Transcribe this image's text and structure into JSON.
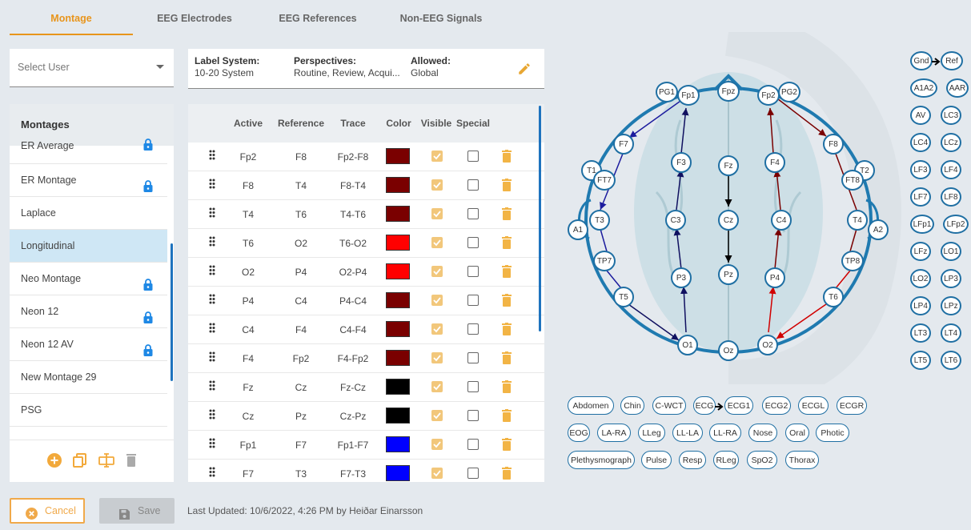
{
  "tabs": [
    {
      "label": "Montage",
      "active": true
    },
    {
      "label": "EEG Electrodes"
    },
    {
      "label": "EEG References"
    },
    {
      "label": "Non-EEG Signals"
    }
  ],
  "select_user": {
    "placeholder": "Select User"
  },
  "label_bar": {
    "label_system": {
      "title": "Label System:",
      "value": "10-20 System"
    },
    "perspectives": {
      "title": "Perspectives:",
      "value": "Routine, Review, Acqui..."
    },
    "allowed": {
      "title": "Allowed:",
      "value": "Global"
    }
  },
  "montages": {
    "header": "Montages",
    "items": [
      {
        "label": "ER Average",
        "locked": true
      },
      {
        "label": "ER Montage",
        "locked": true
      },
      {
        "label": "Laplace",
        "locked": false
      },
      {
        "label": "Longitudinal",
        "locked": false,
        "selected": true
      },
      {
        "label": "Neo Montage",
        "locked": true
      },
      {
        "label": "Neon 12",
        "locked": true
      },
      {
        "label": "Neon 12 AV",
        "locked": true
      },
      {
        "label": "New Montage 29",
        "locked": false
      },
      {
        "label": "PSG",
        "locked": false
      }
    ]
  },
  "table": {
    "columns": {
      "active": "Active",
      "reference": "Reference",
      "trace": "Trace",
      "color": "Color",
      "visible": "Visible",
      "special": "Special"
    },
    "rows": [
      {
        "active": "Fp2",
        "reference": "F8",
        "trace": "Fp2-F8",
        "color": "#7a0000",
        "visible": true,
        "special": false
      },
      {
        "active": "F8",
        "reference": "T4",
        "trace": "F8-T4",
        "color": "#7a0000",
        "visible": true,
        "special": false
      },
      {
        "active": "T4",
        "reference": "T6",
        "trace": "T4-T6",
        "color": "#7a0000",
        "visible": true,
        "special": false
      },
      {
        "active": "T6",
        "reference": "O2",
        "trace": "T6-O2",
        "color": "#ff0000",
        "visible": true,
        "special": false
      },
      {
        "active": "O2",
        "reference": "P4",
        "trace": "O2-P4",
        "color": "#ff0000",
        "visible": true,
        "special": false
      },
      {
        "active": "P4",
        "reference": "C4",
        "trace": "P4-C4",
        "color": "#7a0000",
        "visible": true,
        "special": false
      },
      {
        "active": "C4",
        "reference": "F4",
        "trace": "C4-F4",
        "color": "#7a0000",
        "visible": true,
        "special": false
      },
      {
        "active": "F4",
        "reference": "Fp2",
        "trace": "F4-Fp2",
        "color": "#7a0000",
        "visible": true,
        "special": false
      },
      {
        "active": "Fz",
        "reference": "Cz",
        "trace": "Fz-Cz",
        "color": "#000000",
        "visible": true,
        "special": false
      },
      {
        "active": "Cz",
        "reference": "Pz",
        "trace": "Cz-Pz",
        "color": "#000000",
        "visible": true,
        "special": false
      },
      {
        "active": "Fp1",
        "reference": "F7",
        "trace": "Fp1-F7",
        "color": "#0000ff",
        "visible": true,
        "special": false
      },
      {
        "active": "F7",
        "reference": "T3",
        "trace": "F7-T3",
        "color": "#0000ff",
        "visible": true,
        "special": false
      }
    ]
  },
  "footer": {
    "cancel": "Cancel",
    "save": "Save",
    "last_updated": "Last Updated: 10/6/2022, 4:26 PM by Heiðar Einarsson"
  },
  "head_electrodes": [
    "PG1",
    "Fp1",
    "Fpz",
    "Fp2",
    "PG2",
    "F7",
    "F8",
    "T1",
    "FT7",
    "T2",
    "FT8",
    "F3",
    "Fz",
    "F4",
    "A1",
    "T3",
    "C3",
    "Cz",
    "C4",
    "T4",
    "A2",
    "TP7",
    "TP8",
    "P3",
    "Pz",
    "P4",
    "T5",
    "T6",
    "O1",
    "Oz",
    "O2"
  ],
  "reference_electrodes": [
    "Gnd",
    "Ref",
    "A1A2",
    "AAR",
    "AV",
    "LC3",
    "LC4",
    "LCz",
    "LF3",
    "LF4",
    "LF7",
    "LF8",
    "LFp1",
    "LFp2",
    "LFz",
    "LO1",
    "LO2",
    "LP3",
    "LP4",
    "LPz",
    "LT3",
    "LT4",
    "LT5",
    "LT6"
  ],
  "non_eeg_signals": [
    "Abdomen",
    "Chin",
    "C-WCT",
    "ECG",
    "ECG1",
    "ECG2",
    "ECGL",
    "ECGR",
    "EOG",
    "LA-RA",
    "LLeg",
    "LL-LA",
    "LL-RA",
    "Nose",
    "Oral",
    "Photic",
    "Plethysmograph",
    "Pulse",
    "Resp",
    "RLeg",
    "SpO2",
    "Thorax"
  ],
  "colors": {
    "accent": "#e8951c",
    "link_blue": "#1f6fa3",
    "selection": "#cfe7f5"
  }
}
